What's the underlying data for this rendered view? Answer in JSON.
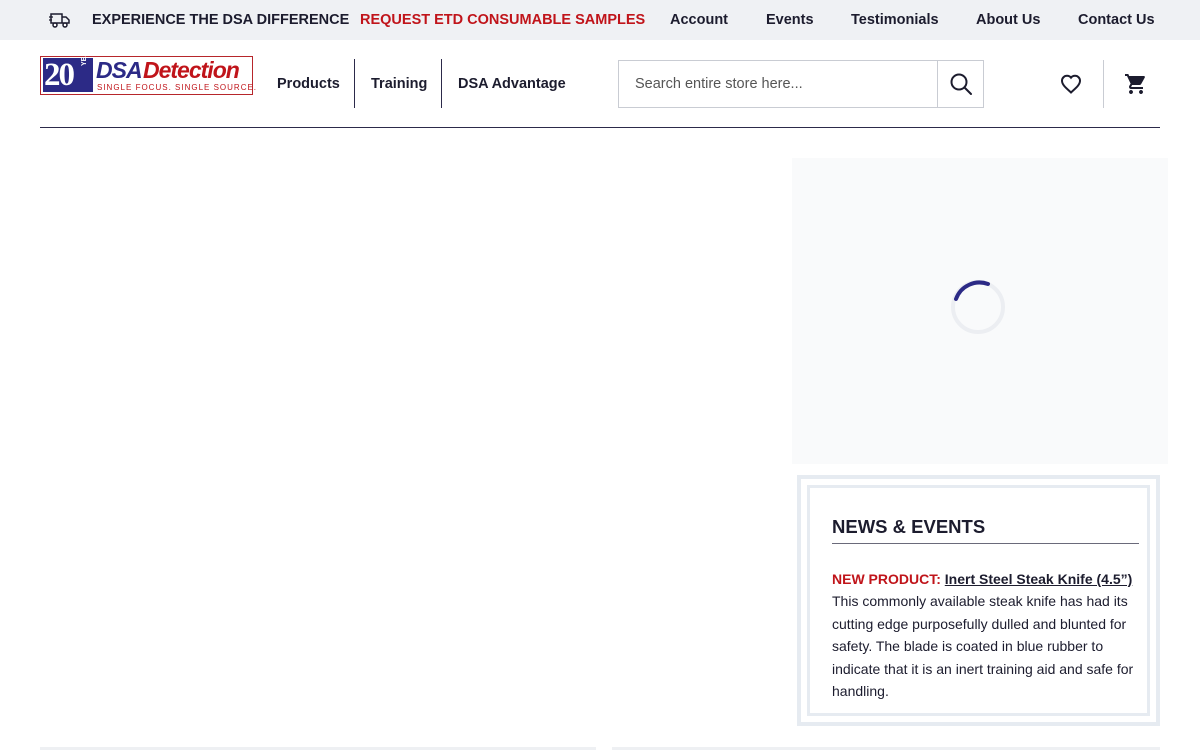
{
  "topbar": {
    "truck_icon": "truck-icon",
    "experience": "EXPERIENCE THE DSA DIFFERENCE",
    "request": "REQUEST ETD CONSUMABLE SAMPLES",
    "links": [
      "Account",
      "Events",
      "Testimonials",
      "About Us",
      "Contact Us"
    ]
  },
  "logo": {
    "number": "20",
    "years": "YEARS",
    "brand_part1": "DSA",
    "brand_part2": "Detection",
    "tagline": "SINGLE FOCUS. SINGLE SOURCE."
  },
  "nav": {
    "items": [
      "Products",
      "Training",
      "DSA Advantage"
    ]
  },
  "search": {
    "placeholder": "Search entire store here...",
    "icon": "search-icon"
  },
  "header_icons": {
    "wishlist": "heart-icon",
    "cart": "cart-icon"
  },
  "news": {
    "title": "NEWS & EVENTS",
    "tag": "NEW PRODUCT:",
    "link": "Inert Steel Steak Knife (4.5”)",
    "body": "This commonly available steak knife has had its cutting edge purposefully dulled and blunted for safety. The blade is coated in blue rubber to indicate that it is an inert training aid and safe for handling."
  },
  "colors": {
    "brand_blue": "#2c2a86",
    "brand_red": "#c0141a",
    "text_dark": "#1c1c2e",
    "topbar_bg": "#eff1f4"
  }
}
